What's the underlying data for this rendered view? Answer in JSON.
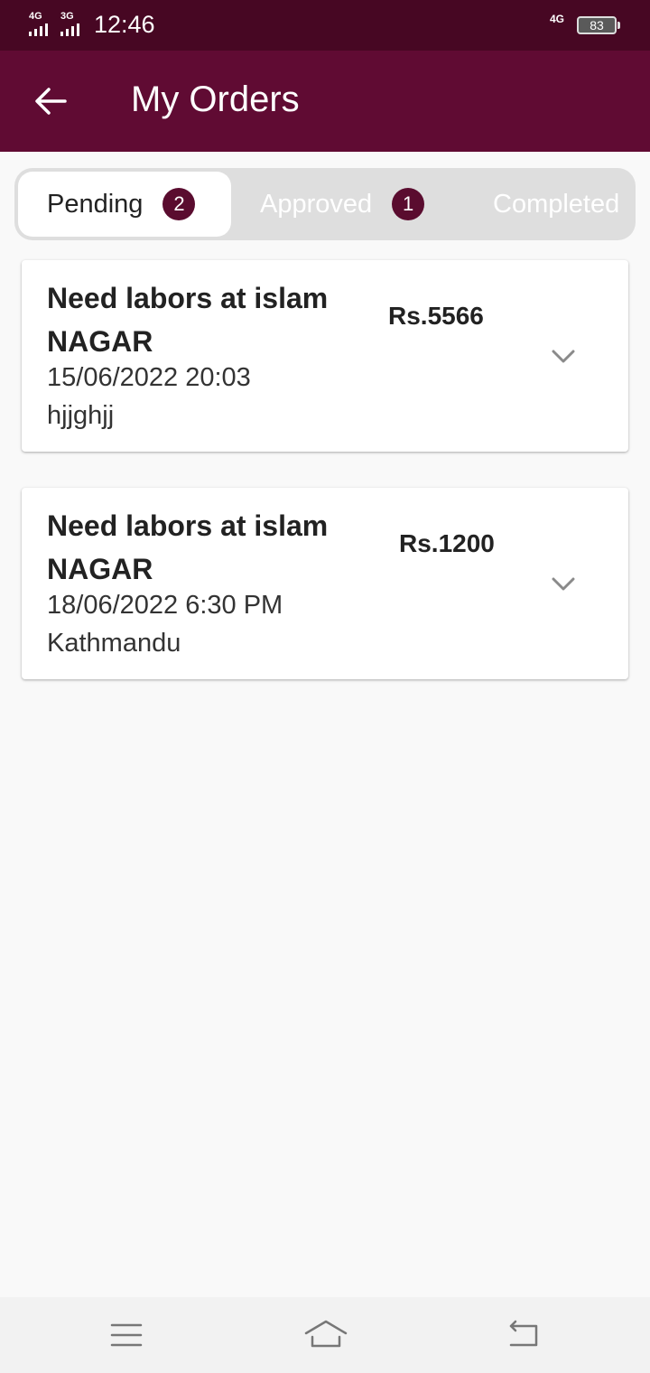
{
  "status_bar": {
    "sim1_network": "4G",
    "sim2_network": "3G",
    "time": "12:46",
    "data_network": "4G",
    "battery": "83",
    "icons": [
      "signal-icon",
      "battery-icon"
    ]
  },
  "app_bar": {
    "title": "My Orders",
    "back_icon": "arrow-left-icon",
    "background_color": "#600b33"
  },
  "tabs": [
    {
      "label": "Pending",
      "count": "2",
      "active": true
    },
    {
      "label": "Approved",
      "count": "1",
      "active": false
    },
    {
      "label": "Completed",
      "active": false
    }
  ],
  "orders": [
    {
      "title": "Need labors at islam NAGAR",
      "date": "15/06/2022 20:03",
      "location": "hjjghjj",
      "price": "Rs.5566"
    },
    {
      "title": "Need labors at islam NAGAR",
      "date": "18/06/2022 6:30 PM",
      "location": "Kathmandu",
      "price": "Rs.1200"
    }
  ],
  "nav_bar": {
    "icons": [
      "menu-icon",
      "home-icon",
      "back-icon"
    ]
  },
  "colors": {
    "status_bar": "#470723",
    "primary": "#600b33",
    "badge": "#5a0c2f"
  }
}
